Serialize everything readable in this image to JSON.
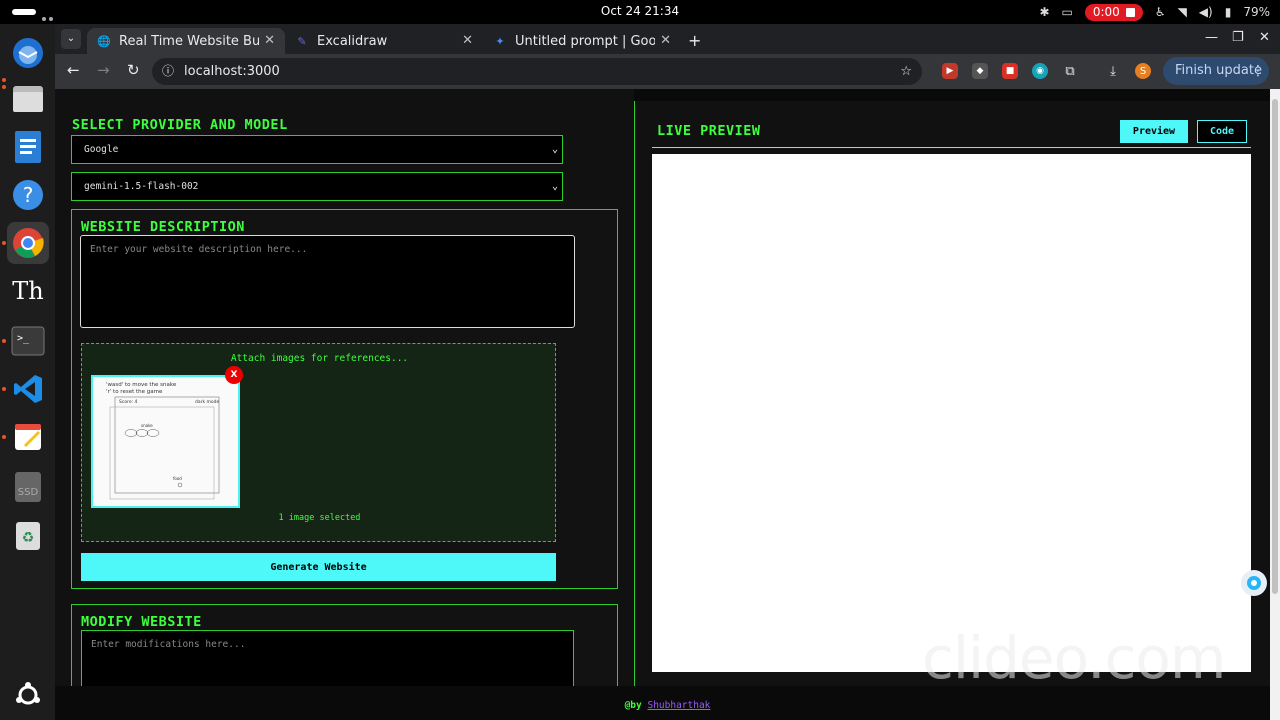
{
  "system": {
    "clock": "Oct 24  21:34",
    "recording_time": "0:00",
    "battery": "79%"
  },
  "browser": {
    "tabs": [
      {
        "title": "Real Time Website Build",
        "active": true
      },
      {
        "title": "Excalidraw",
        "active": false
      },
      {
        "title": "Untitled prompt | Googl",
        "active": false
      }
    ],
    "url": "localhost:3000",
    "finish_update": "Finish update",
    "profile_initial": "S"
  },
  "app": {
    "provider_section_title": "SELECT PROVIDER AND MODEL",
    "provider_value": "Google",
    "model_value": "gemini-1.5-flash-002",
    "description_title": "WEBSITE DESCRIPTION",
    "description_placeholder": "Enter your website description here...",
    "attach_label": "Attach images for references...",
    "remove_image_label": "X",
    "images_selected": "1 image selected",
    "generate_button": "Generate Website",
    "modify_title": "MODIFY WEBSITE",
    "modify_placeholder": "Enter modifications here...",
    "live_preview_title": "LIVE PREVIEW",
    "preview_button": "Preview",
    "code_button": "Code",
    "footer_prefix": "@by",
    "footer_author": "Shubharthak"
  },
  "thumbnail_sketch": {
    "line1": "'wasd' to move the snake",
    "line2": "'r' to reset the game",
    "score": "Score: 4",
    "mode": "dark mode",
    "snake": "snake",
    "food": "food"
  },
  "watermark": "clideo.com",
  "colors": {
    "accent_green": "#3dff3d",
    "accent_cyan": "#4ff8f8",
    "background": "#111111"
  },
  "icons": {
    "dock": [
      "thunderbird-icon",
      "files-icon",
      "writer-icon",
      "help-icon",
      "chrome-icon",
      "typora-icon",
      "terminal-icon",
      "vscode-icon",
      "text-editor-icon",
      "ssd-icon",
      "trash-icon",
      "ubuntu-icon"
    ]
  }
}
